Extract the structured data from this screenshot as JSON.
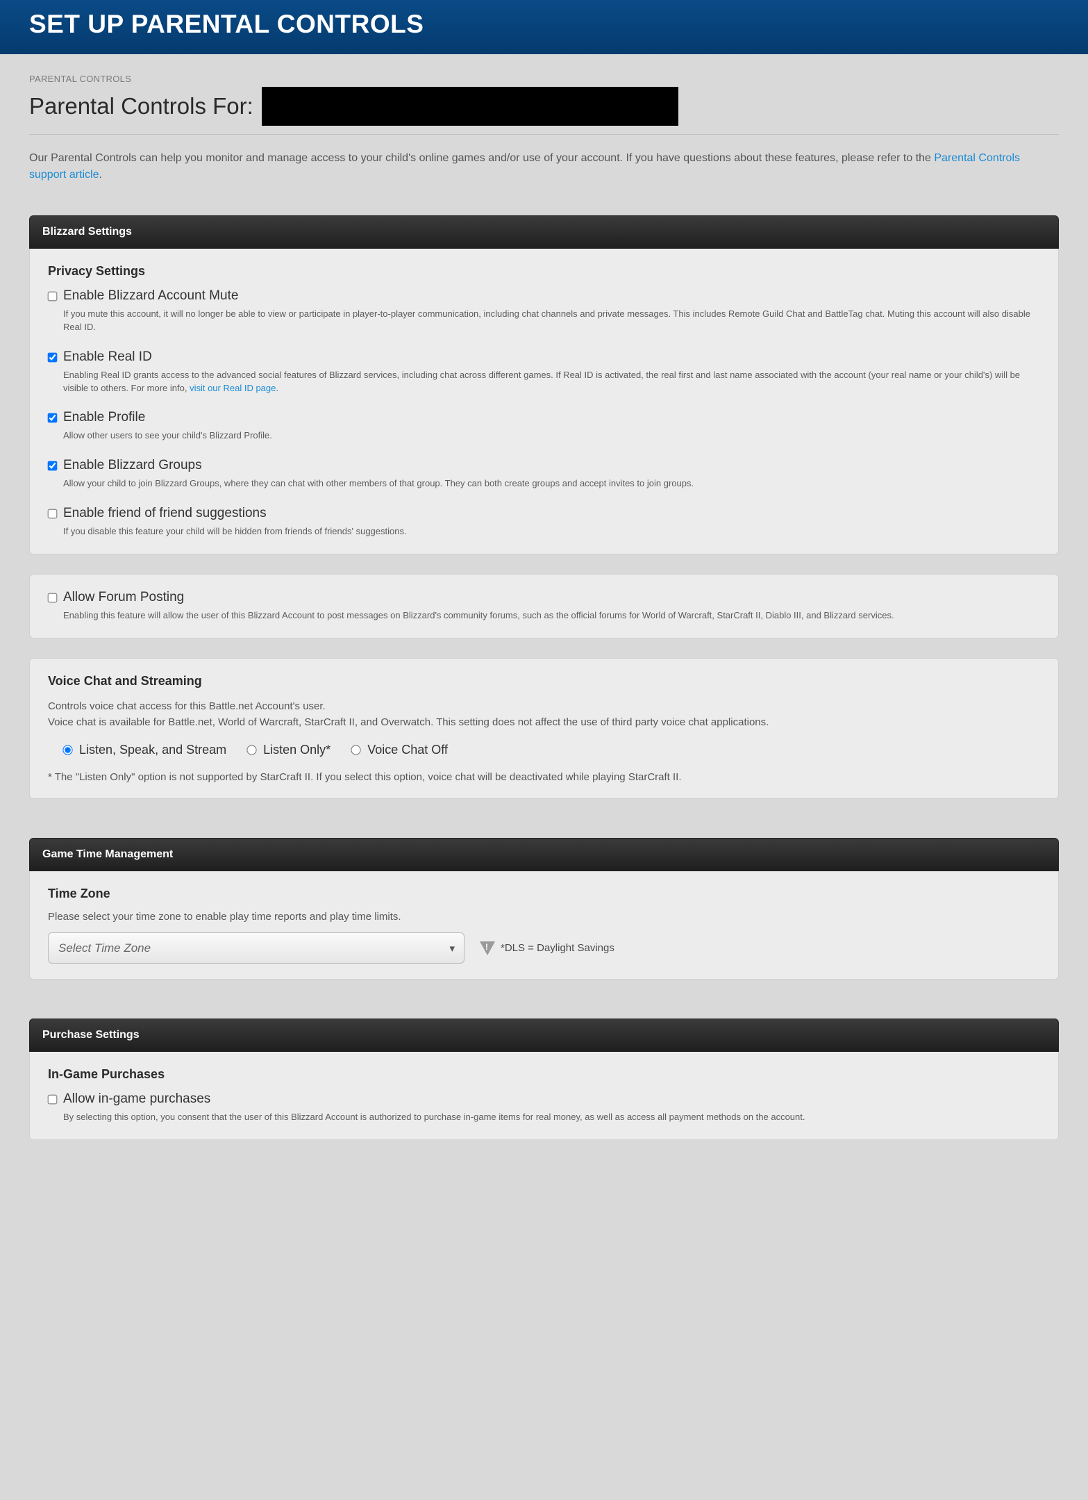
{
  "hero": {
    "title": "SET UP PARENTAL CONTROLS"
  },
  "breadcrumb": "PARENTAL CONTROLS",
  "page_title": "Parental Controls For:",
  "intro": {
    "text_a": "Our Parental Controls can help you monitor and manage access to your child's online games and/or use of your account. If you have questions about these features, please refer to the ",
    "link": "Parental Controls support article",
    "text_b": "."
  },
  "sections": {
    "blizzard": {
      "title": "Blizzard Settings"
    },
    "gtm": {
      "title": "Game Time Management"
    },
    "purchase": {
      "title": "Purchase Settings"
    }
  },
  "privacy": {
    "heading": "Privacy Settings",
    "mute": {
      "label": "Enable Blizzard Account Mute",
      "checked": false,
      "desc": "If you mute this account, it will no longer be able to view or participate in player-to-player communication, including chat channels and private messages. This includes Remote Guild Chat and BattleTag chat. Muting this account will also disable Real ID."
    },
    "realid": {
      "label": "Enable Real ID",
      "checked": true,
      "desc_a": "Enabling Real ID grants access to the advanced social features of Blizzard services, including chat across different games. If Real ID is activated, the real first and last name associated with the account (your real name or your child's) will be visible to others. For more info, ",
      "link": "visit our Real ID page",
      "desc_b": "."
    },
    "profile": {
      "label": "Enable Profile",
      "checked": true,
      "desc": "Allow other users to see your child's Blizzard Profile."
    },
    "groups": {
      "label": "Enable Blizzard Groups",
      "checked": true,
      "desc": "Allow your child to join Blizzard Groups, where they can chat with other members of that group. They can both create groups and accept invites to join groups."
    },
    "fof": {
      "label": "Enable friend of friend suggestions",
      "checked": false,
      "desc": "If you disable this feature your child will be hidden from friends of friends' suggestions."
    }
  },
  "forum": {
    "label": "Allow Forum Posting",
    "checked": false,
    "desc": "Enabling this feature will allow the user of this Blizzard Account to post messages on Blizzard's community forums, such as the official forums for World of Warcraft, StarCraft II, Diablo III, and Blizzard services."
  },
  "voice": {
    "heading": "Voice Chat and Streaming",
    "desc1": "Controls voice chat access for this Battle.net Account's user.",
    "desc2": "Voice chat is available for Battle.net, World of Warcraft, StarCraft II, and Overwatch. This setting does not affect the use of third party voice chat applications.",
    "options": {
      "all": "Listen, Speak, and Stream",
      "listen": "Listen Only*",
      "off": "Voice Chat Off"
    },
    "selected": "all",
    "note": "* The \"Listen Only\" option is not supported by StarCraft II. If you select this option, voice chat will be deactivated while playing StarCraft II."
  },
  "timezone": {
    "heading": "Time Zone",
    "desc": "Please select your time zone to enable play time reports and play time limits.",
    "placeholder": "Select Time Zone",
    "dls": "*DLS = Daylight Savings"
  },
  "purchase": {
    "heading": "In-Game Purchases",
    "allow": {
      "label": "Allow in-game purchases",
      "checked": false,
      "desc": "By selecting this option, you consent that the user of this Blizzard Account is authorized to purchase in-game items for real money, as well as access all payment methods on the account."
    }
  }
}
